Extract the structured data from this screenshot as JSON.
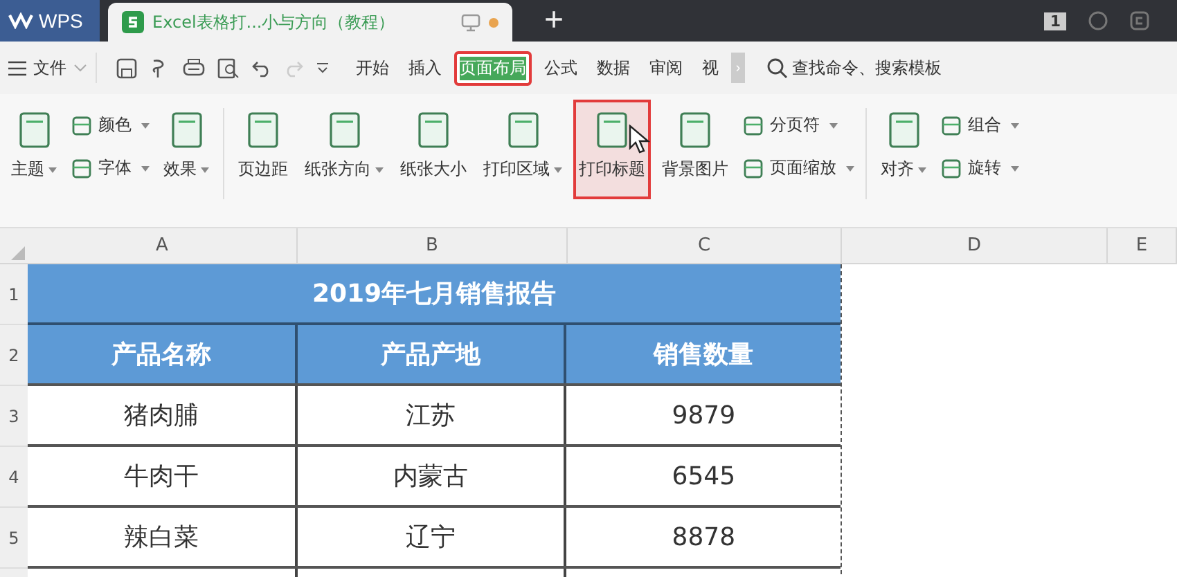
{
  "title_bar": {
    "app_tab": "WPS",
    "doc_tab": {
      "title": "Excel表格打...小与方向（教程）",
      "unsaved": true
    },
    "new_tab": "+",
    "badge": "1"
  },
  "menu": {
    "file": "文件",
    "tabs": [
      {
        "label": "开始",
        "selected": false
      },
      {
        "label": "插入",
        "selected": false
      },
      {
        "label": "页面布局",
        "selected": true
      },
      {
        "label": "公式",
        "selected": false
      },
      {
        "label": "数据",
        "selected": false
      },
      {
        "label": "审阅",
        "selected": false
      },
      {
        "label": "视",
        "selected": false
      }
    ],
    "more": "›",
    "search": "查找命令、搜索模板"
  },
  "ribbon": {
    "groups": [
      [
        {
          "kind": "large",
          "label": "主题",
          "dropdown": true,
          "highlighted": false
        },
        {
          "kind": "pair",
          "items": [
            {
              "label": "颜色",
              "dropdown": true
            },
            {
              "label": "字体",
              "dropdown": true
            }
          ]
        },
        {
          "kind": "large",
          "label": "效果",
          "dropdown": true,
          "highlighted": false
        }
      ],
      [
        {
          "kind": "large",
          "label": "页边距",
          "dropdown": false,
          "highlighted": false
        },
        {
          "kind": "large",
          "label": "纸张方向",
          "dropdown": true,
          "highlighted": false
        },
        {
          "kind": "large",
          "label": "纸张大小",
          "dropdown": false,
          "highlighted": false
        },
        {
          "kind": "large",
          "label": "打印区域",
          "dropdown": true,
          "highlighted": false
        },
        {
          "kind": "large",
          "label": "打印标题",
          "dropdown": false,
          "highlighted": true
        },
        {
          "kind": "large",
          "label": "背景图片",
          "dropdown": false,
          "highlighted": false
        },
        {
          "kind": "pair",
          "items": [
            {
              "label": "分页符",
              "dropdown": true
            },
            {
              "label": "页面缩放",
              "dropdown": true
            }
          ]
        }
      ],
      [
        {
          "kind": "large",
          "label": "对齐",
          "dropdown": true,
          "highlighted": false
        },
        {
          "kind": "pair",
          "items": [
            {
              "label": "组合",
              "dropdown": true
            },
            {
              "label": "旋转",
              "dropdown": true
            }
          ]
        }
      ]
    ]
  },
  "sheet": {
    "columns": [
      "A",
      "B",
      "C",
      "D",
      "E"
    ],
    "row_numbers": [
      "1",
      "2",
      "3",
      "4",
      "5"
    ],
    "title": "2019年七月销售报告",
    "header": [
      "产品名称",
      "产品产地",
      "销售数量"
    ],
    "rows": [
      [
        "猪肉脯",
        "江苏",
        "9879"
      ],
      [
        "牛肉干",
        "内蒙古",
        "6545"
      ],
      [
        "辣白菜",
        "辽宁",
        "8878"
      ]
    ]
  }
}
